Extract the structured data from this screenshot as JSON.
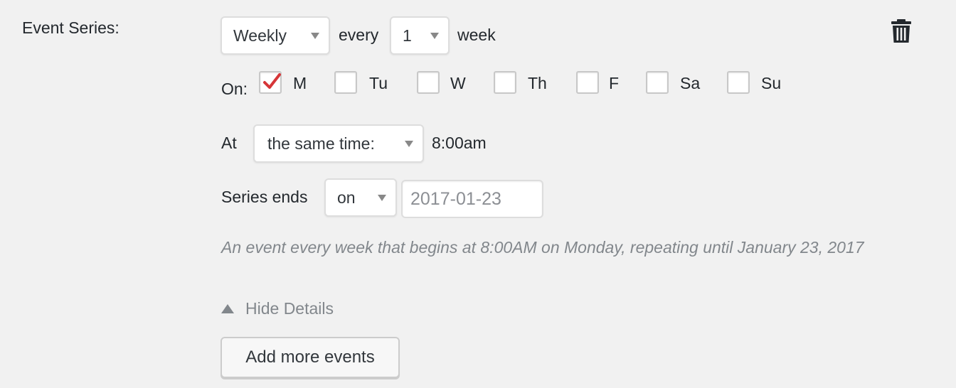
{
  "series": {
    "label": "Event Series:",
    "frequency": "Weekly",
    "every_label": "every",
    "interval": "1",
    "unit_label": "week"
  },
  "on": {
    "label": "On:",
    "days": [
      {
        "label": "M",
        "checked": true
      },
      {
        "label": "Tu",
        "checked": false
      },
      {
        "label": "W",
        "checked": false
      },
      {
        "label": "Th",
        "checked": false
      },
      {
        "label": "F",
        "checked": false
      },
      {
        "label": "Sa",
        "checked": false
      },
      {
        "label": "Su",
        "checked": false
      }
    ]
  },
  "at": {
    "label": "At",
    "mode": "the same time:",
    "time": "8:00am"
  },
  "ends": {
    "label": "Series ends",
    "mode": "on",
    "date": "2017-01-23"
  },
  "description": "An event every week that begins at 8:00AM on Monday, repeating until January 23, 2017",
  "toggle": {
    "label": "Hide Details"
  },
  "add_button": {
    "label": "Add more events"
  },
  "icons": {
    "delete": "trash-icon",
    "collapse": "triangle-up-icon",
    "check": "checkmark-icon"
  },
  "colors": {
    "check": "#d63638",
    "background": "#f1f1f1",
    "muted_text": "#82878c"
  }
}
